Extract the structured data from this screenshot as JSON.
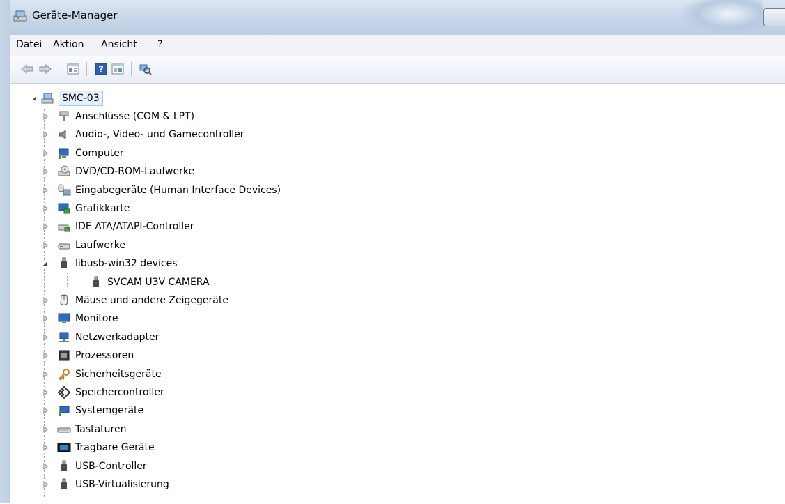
{
  "window": {
    "title": "Geräte-Manager"
  },
  "menu": [
    "Datei",
    "Aktion",
    "Ansicht",
    "?"
  ],
  "toolbar": {
    "buttons": [
      "back-icon",
      "forward-icon",
      "properties-icon",
      "help-icon",
      "show-hidden-icon",
      "scan-hardware-icon"
    ]
  },
  "tree": {
    "root": "SMC-03",
    "categories": [
      {
        "label": "Anschlüsse (COM & LPT)",
        "icon": "port-icon",
        "expanded": false
      },
      {
        "label": "Audio-, Video- und Gamecontroller",
        "icon": "speaker-icon",
        "expanded": false
      },
      {
        "label": "Computer",
        "icon": "computer-icon",
        "expanded": false
      },
      {
        "label": "DVD/CD-ROM-Laufwerke",
        "icon": "dvd-drive-icon",
        "expanded": false
      },
      {
        "label": "Eingabegeräte (Human Interface Devices)",
        "icon": "hid-icon",
        "expanded": false
      },
      {
        "label": "Grafikkarte",
        "icon": "display-adapter-icon",
        "expanded": false
      },
      {
        "label": "IDE ATA/ATAPI-Controller",
        "icon": "ide-controller-icon",
        "expanded": false
      },
      {
        "label": "Laufwerke",
        "icon": "disk-drive-icon",
        "expanded": false
      },
      {
        "label": "libusb-win32 devices",
        "icon": "usb-plug-icon",
        "expanded": true
      },
      {
        "label": "SVCAM U3V CAMERA",
        "icon": "usb-plug-icon",
        "child": true
      },
      {
        "label": "Mäuse und andere Zeigegeräte",
        "icon": "mouse-icon",
        "expanded": false
      },
      {
        "label": "Monitore",
        "icon": "monitor-icon",
        "expanded": false
      },
      {
        "label": "Netzwerkadapter",
        "icon": "network-adapter-icon",
        "expanded": false
      },
      {
        "label": "Prozessoren",
        "icon": "processor-icon",
        "expanded": false
      },
      {
        "label": "Sicherheitsgeräte",
        "icon": "security-key-icon",
        "expanded": false
      },
      {
        "label": "Speichercontroller",
        "icon": "storage-controller-icon",
        "expanded": false
      },
      {
        "label": "Systemgeräte",
        "icon": "system-devices-icon",
        "expanded": false
      },
      {
        "label": "Tastaturen",
        "icon": "keyboard-icon",
        "expanded": false
      },
      {
        "label": "Tragbare Geräte",
        "icon": "portable-device-icon",
        "expanded": false
      },
      {
        "label": "USB-Controller",
        "icon": "usb-plug-icon",
        "expanded": false
      },
      {
        "label": "USB-Virtualisierung",
        "icon": "usb-plug-icon",
        "expanded": false
      }
    ]
  }
}
